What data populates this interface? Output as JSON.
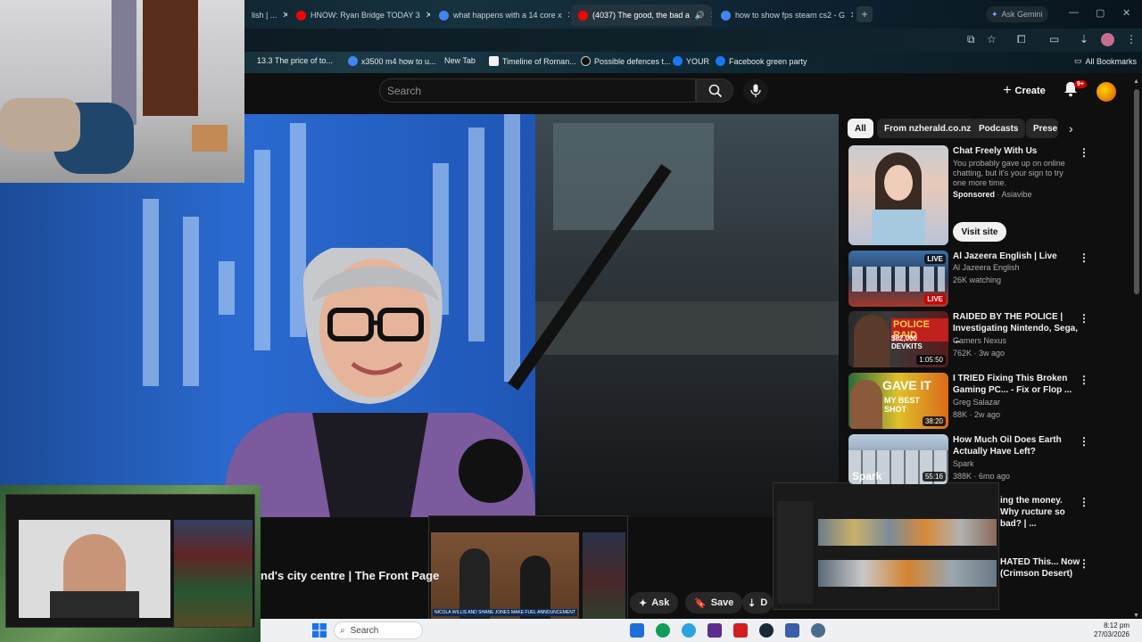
{
  "browser": {
    "tabs": [
      {
        "label": "lish | ...",
        "color": "#c0c0c0"
      },
      {
        "label": "HNOW: Ryan Bridge TODAY 3",
        "color": "#ff0000"
      },
      {
        "label": "what happens with a 14 core x",
        "color": "#4285f4"
      },
      {
        "label": "(4037) The good, the bad a",
        "color": "#ff0000"
      },
      {
        "label": "how to show fps steam cs2 - G",
        "color": "#4285f4"
      }
    ],
    "gemini_label": "Ask Gemini",
    "bookmarks": [
      {
        "label": "13.3 The price of to...",
        "color": "#3b6b8c"
      },
      {
        "label": "x3500 m4 how to u...",
        "color": "#4285f4"
      },
      {
        "label": "New Tab",
        "color": "#888888"
      },
      {
        "label": "Timeline of Roman...",
        "color": "#f2f2f2"
      },
      {
        "label": "Possible defences t...",
        "color": "#111111"
      },
      {
        "label": "YOUR",
        "color": "#1877f2"
      },
      {
        "label": "Facebook green party",
        "color": "#1877f2"
      }
    ],
    "all_bookmarks": "All Bookmarks"
  },
  "youtube": {
    "search_placeholder": "Search",
    "create_label": "Create",
    "notif_badge": "9+",
    "video_title": "nd's city centre | The Front Page",
    "actions": {
      "ask": "Ask",
      "save": "Save",
      "download": "D"
    },
    "chips": [
      "All",
      "From nzherald.co.nz",
      "Podcasts",
      "Prese"
    ],
    "sponsored": {
      "title": "Chat Freely With Us",
      "desc": "You probably gave up on online chatting, but it's your sign to try one more time.",
      "sponsored_label": "Sponsored",
      "advertiser": "Asiavibe",
      "visit_label": "Visit site"
    },
    "recommendations": [
      {
        "title": "Al Jazeera English | Live",
        "channel": "Al Jazeera English",
        "meta": "26K watching",
        "badge": "LIVE"
      },
      {
        "title": "RAIDED BY THE POLICE | Investigating Nintendo, Sega, ...",
        "channel": "Gamers Nexus",
        "meta": "762K · 3w ago",
        "duration": "1:05:50",
        "thumb_text": "POLICE RAID",
        "thumb_sub": "$82,000 DEVKITS"
      },
      {
        "title": "I TRIED Fixing This Broken Gaming PC... - Fix or Flop ...",
        "channel": "Greg Salazar",
        "meta": "88K · 2w ago",
        "duration": "38:20",
        "thumb_text": "GAVE IT",
        "thumb_sub": "MY BEST SHOT"
      },
      {
        "title": "How Much Oil Does Earth Actually Have Left?",
        "channel": "Spark",
        "meta": "388K · 6mo ago",
        "duration": "55:16",
        "thumb_text": "Spark"
      },
      {
        "title": "ing the money. Why ructure so bad? | ..."
      },
      {
        "title": "HATED This... Now (Crimson Desert)"
      }
    ]
  },
  "pip": {
    "parliament_caption": "NICOLA WILLIS AND SHANE JONES MAKE FUEL ANNOUNCEMENT"
  },
  "taskbar": {
    "search_placeholder": "Search",
    "time": "8:12 pm",
    "date": "27/03/2026"
  }
}
